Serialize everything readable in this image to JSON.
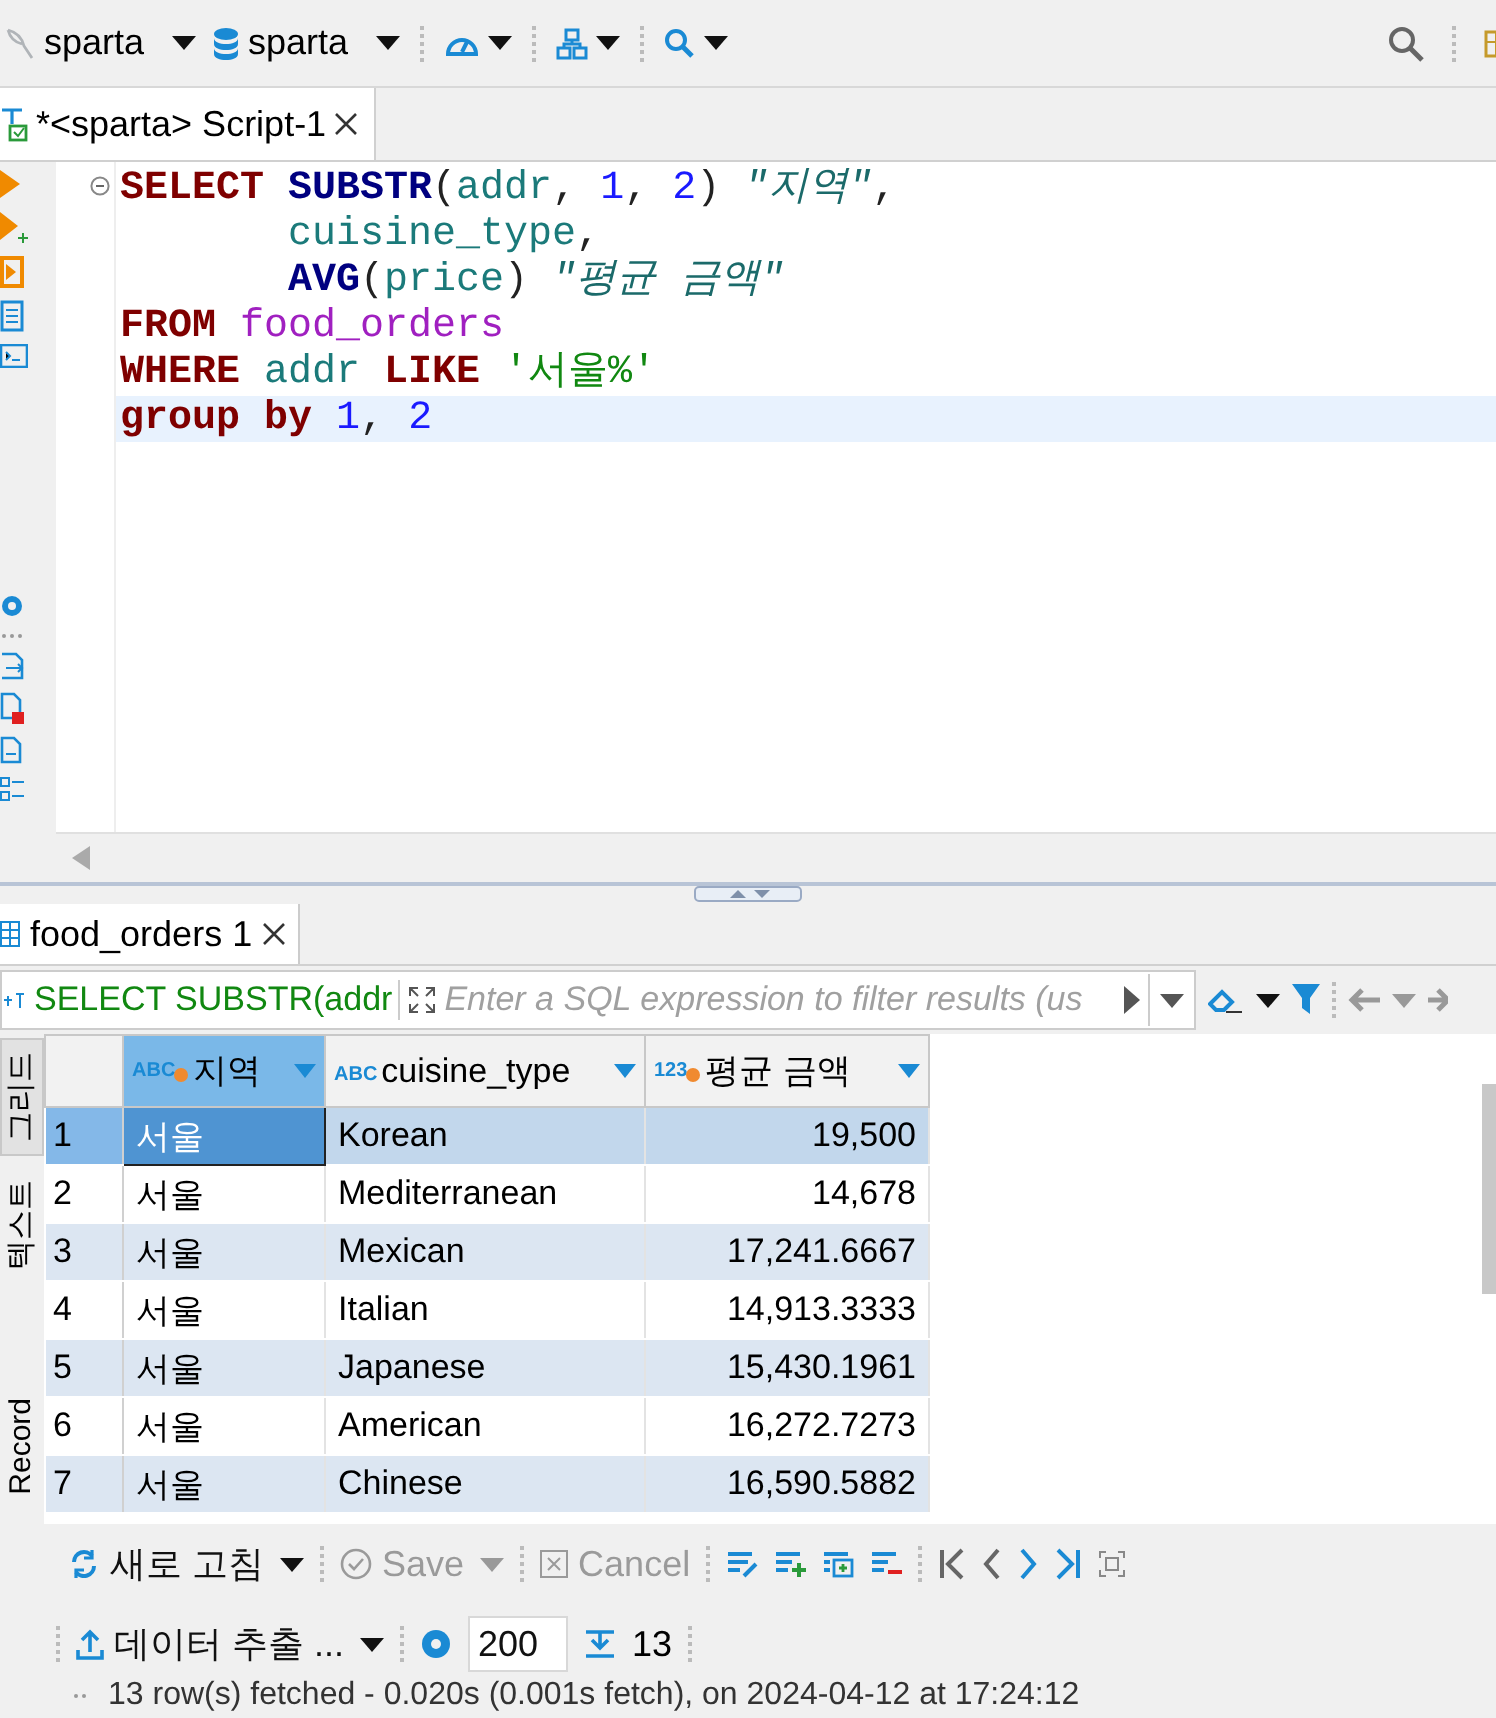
{
  "toolbar": {
    "items": [
      {
        "kind": "connection",
        "label": "sparta"
      },
      {
        "kind": "database",
        "label": "sparta"
      },
      {
        "kind": "dashboard"
      },
      {
        "kind": "schema"
      },
      {
        "kind": "search"
      }
    ]
  },
  "editor_tab": {
    "label": "*<sparta> Script-1",
    "selected": true
  },
  "code_lines": [
    {
      "kind": "start",
      "current": false,
      "tokens": [
        {
          "kind": "keyword",
          "text": "SELECT "
        },
        {
          "kind": "function",
          "text": "SUBSTR"
        },
        {
          "kind": "plain",
          "text": "("
        },
        {
          "kind": "identifier",
          "text": "addr"
        },
        {
          "kind": "plain",
          "text": ", "
        },
        {
          "kind": "number",
          "text": "1"
        },
        {
          "kind": "plain",
          "text": ", "
        },
        {
          "kind": "number",
          "text": "2"
        },
        {
          "kind": "plain",
          "text": ") "
        },
        {
          "kind": "alias",
          "text": "\"지역\""
        },
        {
          "kind": "plain",
          "text": ","
        }
      ]
    },
    {
      "kind": "continuation",
      "current": false,
      "tokens": [
        {
          "kind": "identifier",
          "text": "cuisine_type"
        },
        {
          "kind": "plain",
          "text": ","
        }
      ]
    },
    {
      "kind": "continuation",
      "current": false,
      "tokens": [
        {
          "kind": "function",
          "text": "AVG"
        },
        {
          "kind": "plain",
          "text": "("
        },
        {
          "kind": "identifier",
          "text": "price"
        },
        {
          "kind": "plain",
          "text": ") "
        },
        {
          "kind": "alias",
          "text": "\"평균 금액\""
        }
      ]
    },
    {
      "kind": "start",
      "current": false,
      "tokens": [
        {
          "kind": "keyword",
          "text": "FROM "
        },
        {
          "kind": "table",
          "text": "food_orders"
        }
      ]
    },
    {
      "kind": "start",
      "current": false,
      "tokens": [
        {
          "kind": "keyword",
          "text": "WHERE "
        },
        {
          "kind": "identifier",
          "text": "addr "
        },
        {
          "kind": "keyword",
          "text": "LIKE "
        },
        {
          "kind": "string",
          "text": "'서울%'"
        }
      ]
    },
    {
      "kind": "start",
      "current": true,
      "tokens": [
        {
          "kind": "keyword",
          "text": "group "
        },
        {
          "kind": "keyword",
          "text": "by "
        },
        {
          "kind": "number",
          "text": "1"
        },
        {
          "kind": "plain",
          "text": ", "
        },
        {
          "kind": "number",
          "text": "2"
        }
      ]
    }
  ],
  "results_tab": {
    "label": "food_orders 1",
    "selected": true
  },
  "query_label": "SELECT SUBSTR(addr",
  "filter": {
    "placeholder": "Enter a SQL expression to filter results (us"
  },
  "view_tabs": [
    {
      "label": "그리드",
      "selected": true
    },
    {
      "label": "텍스트",
      "selected": false
    },
    {
      "label": "Record",
      "selected": false
    }
  ],
  "grid": {
    "columns": [
      {
        "type_label": "ABC",
        "label": "지역",
        "marked": true,
        "selected": true,
        "kind": "text"
      },
      {
        "type_label": "ABC",
        "label": "cuisine_type",
        "marked": false,
        "selected": false,
        "kind": "text"
      },
      {
        "type_label": "123",
        "label": "평균 금액",
        "marked": true,
        "selected": false,
        "kind": "number"
      }
    ],
    "rows": [
      {
        "number": "1",
        "selected": true,
        "cells": [
          "서울",
          "Korean",
          "19,500"
        ]
      },
      {
        "number": "2",
        "selected": false,
        "cells": [
          "서울",
          "Mediterranean",
          "14,678"
        ]
      },
      {
        "number": "3",
        "selected": false,
        "cells": [
          "서울",
          "Mexican",
          "17,241.6667"
        ]
      },
      {
        "number": "4",
        "selected": false,
        "cells": [
          "서울",
          "Italian",
          "14,913.3333"
        ]
      },
      {
        "number": "5",
        "selected": false,
        "cells": [
          "서울",
          "Japanese",
          "15,430.1961"
        ]
      },
      {
        "number": "6",
        "selected": false,
        "cells": [
          "서울",
          "American",
          "16,272.7273"
        ]
      },
      {
        "number": "7",
        "selected": false,
        "cells": [
          "서울",
          "Chinese",
          "16,590.5882"
        ]
      }
    ]
  },
  "footer": {
    "buttons": [
      {
        "label": "새로 고침",
        "disabled": false
      },
      {
        "label": "Save",
        "disabled": true
      },
      {
        "label": "Cancel",
        "disabled": true
      }
    ],
    "export_label": "데이터 추출 ...",
    "fetch_size": "200",
    "row_count": "13",
    "status": "13 row(s) fetched - 0.020s (0.001s fetch), on 2024-04-12 at 17:24:12"
  }
}
